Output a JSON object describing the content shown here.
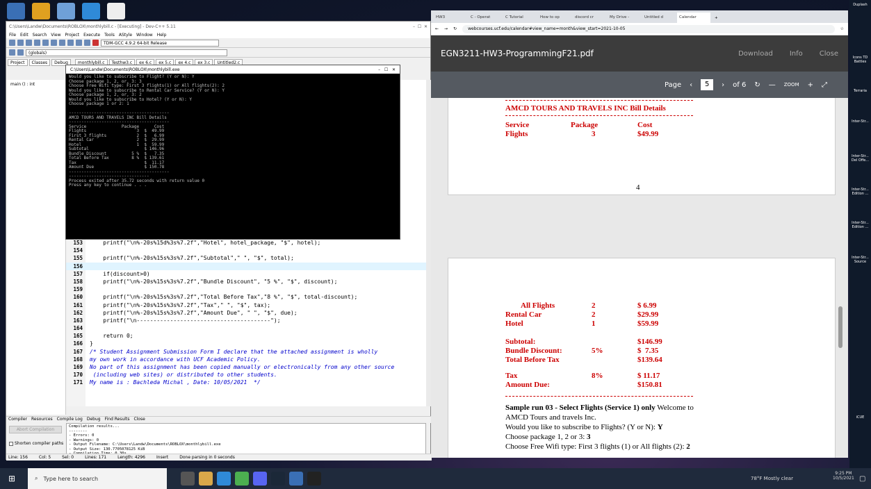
{
  "devc": {
    "title": "C:\\Users\\Landw\\Documents\\ROBLOX\\monthlybill.c - [Executing] - Dev-C++ 5.11",
    "menu": [
      "File",
      "Edit",
      "Search",
      "View",
      "Project",
      "Execute",
      "Tools",
      "AStyle",
      "Window",
      "Help"
    ],
    "compiler": "TDM-GCC 4.9.2 64-bit Release",
    "globals": "(globals)",
    "tabs": [
      "monthlybill.c",
      "Testhw3.c",
      "ex 6.c",
      "ex 5.c",
      "ex 4.c",
      "ex 3.c",
      "Untitled2.c"
    ],
    "panel_tabs": [
      "Project",
      "Classes",
      "Debug"
    ],
    "tree_item": "main () : int",
    "bottom_tabs": [
      "Compiler",
      "Resources",
      "Compile Log",
      "Debug",
      "Find Results",
      "Close"
    ],
    "abort": "Abort Compilation",
    "shorten": "Shorten compiler paths",
    "log": "Compilation results...\n--------\n- Errors: 0\n- Warnings: 0\n- Output Filename: C:\\Users\\Landw\\Documents\\ROBLOX\\monthlybill.exe\n- Output Size: 130.7705078125 KiB\n- Compilation Time: 0.30s",
    "status": {
      "line": "Line: 156",
      "col": "Col: 5",
      "sel": "Sel: 0",
      "lines": "Lines: 171",
      "length": "Length: 4296",
      "mode": "Insert",
      "msg": "Done parsing in 0 seconds"
    }
  },
  "code_lines": [
    {
      "n": "153",
      "t": "    printf(\"\\n%-20s%15d%3s%7.2f\",\"Hotel\", hotel_package, \"$\", hotel);"
    },
    {
      "n": "154",
      "t": ""
    },
    {
      "n": "155",
      "t": "    printf(\"\\n%-20s%15s%3s%7.2f\",\"Subtotal\",\" \", \"$\", total);"
    },
    {
      "n": "156",
      "t": ""
    },
    {
      "n": "157",
      "t": "    if(discount>0)"
    },
    {
      "n": "158",
      "t": "    printf(\"\\n%-20s%15s%3s%7.2f\",\"Bundle Discount\", \"5 %\", \"$\", discount);"
    },
    {
      "n": "159",
      "t": ""
    },
    {
      "n": "160",
      "t": "    printf(\"\\n%-20s%15s%3s%7.2f\",\"Total Before Tax\",\"8 %\", \"$\", total-discount);"
    },
    {
      "n": "161",
      "t": "    printf(\"\\n%-20s%15s%3s%7.2f\",\"Tax\",\" \", \"$\", tax);"
    },
    {
      "n": "162",
      "t": "    printf(\"\\n%-20s%15s%3s%7.2f\",\"Amount Due\", \" \", \"$\", due);"
    },
    {
      "n": "163",
      "t": "    printf(\"\\n----------------------------------------\");"
    },
    {
      "n": "164",
      "t": ""
    },
    {
      "n": "165",
      "t": "    return 0;"
    },
    {
      "n": "166",
      "t": "}"
    },
    {
      "n": "167",
      "t": "/* Student Assignment Submission Form I declare that the attached assignment is wholly"
    },
    {
      "n": "168",
      "t": "my own work in accordance with UCF Academic Policy."
    },
    {
      "n": "169",
      "t": "No part of this assignment has been copied manually or electronically from any other source"
    },
    {
      "n": "170",
      "t": " (including web sites) or distributed to other students."
    },
    {
      "n": "171",
      "t": "My name is : Bachleda Michal , Date: 10/05/2021  */"
    }
  ],
  "console": {
    "title": "C:\\Users\\Landw\\Documents\\ROBLOX\\monthlybill.exe",
    "output": "Would you like to subscribe to Flight? (Y or N): Y\nChoose package 1, 2, or, 3: 3\nChoose Free Wifi type: First 3 flights(1) or All flights(2): 2\nWould you like to subscribe to Rental Car Service? (Y or N): Y\nChoose package 1, 2, or, 3: 2\nWould you like to subscribe to Hotel? (Y or N): Y\nChoose package 1 or 2: 1\n\n----------------------------------------\nAMCD TOURS AND TRAVELS INC Bill Details\n----------------------------------------\nService              Package      Cost\nFlights                    3  $  49.99\nFirst 3 flights            2  $   6.99\nRental Car                 2  $  29.99\nHotel                      1  $  59.99\nSubtotal                      $ 146.96\nBundle Discount          5 %  $   7.35\nTotal Before Tax         8 %  $ 139.61\nTax                           $  11.17\nAmount Due                    $ 150.78\n----------------------------------------\n--------------------------------\nProcess exited after 35.72 seconds with return value 0\nPress any key to continue . . ."
  },
  "chrome": {
    "tabs": [
      "HW3",
      "C - Operat",
      "C Tutorial",
      "How to op",
      "discord cr",
      "My Drive -",
      "Untitled d",
      "Calendar"
    ],
    "url": "webcourses.ucf.edu/calendar#view_name=month&view_start=2021-10-05"
  },
  "pdf": {
    "title": "EGN3211-HW3-ProgrammingF21.pdf",
    "download": "Download",
    "info": "Info",
    "close": "Close",
    "page_label": "Page",
    "page_num": "5",
    "of": "of 6",
    "zoom": "ZOOM",
    "page4": {
      "heading": "AMCD TOURS AND TRAVELS INC Bill Details",
      "h_service": "Service",
      "h_package": "Package",
      "h_cost": "Cost",
      "r1": "Flights",
      "r1p": "3",
      "r1c": "$49.99",
      "page_no": "4"
    },
    "page5": {
      "rows": [
        [
          "All Flights",
          "2",
          "$ 6.99"
        ],
        [
          "Rental Car",
          "2",
          "$29.99"
        ],
        [
          "Hotel",
          "1",
          "$59.99"
        ]
      ],
      "subtotal": [
        "Subtotal:",
        "",
        "$146.99"
      ],
      "bundle": [
        "Bundle Discount:",
        "5%",
        "$  7.35"
      ],
      "tbt": [
        "Total Before Tax",
        "",
        "$139.64"
      ],
      "tax": [
        "Tax",
        "8%",
        "$ 11.17"
      ],
      "due": [
        "Amount Due:",
        "",
        "$150.81"
      ],
      "sample_bold": "Sample run 03 - Select Flights (Service 1) only",
      "sample_rest": " Welcome to",
      "p1": "AMCD Tours and travels Inc.",
      "p2": "Would you like to subscribe to Flights? (Y or N): ",
      "p2b": "Y",
      "p3": "Choose package 1, 2 or 3: ",
      "p3b": "3",
      "p4": "Choose Free Wifi type: First 3 flights (1) or All flights (2): ",
      "p4b": "2"
    }
  },
  "right_icons": [
    "Duplash",
    "Icons TD Battles",
    "Terraria",
    "Inter-Str...",
    "Inter-Str... Del Offe...",
    "Inter-Str... Edition ...",
    "Inter-Str... Edition ...",
    "Inter-Str... Source",
    "iCUE"
  ],
  "taskbar": {
    "search": "Type here to search",
    "weather": "78°F  Mostly clear",
    "time": "9:25 PM",
    "date": "10/5/2021"
  }
}
